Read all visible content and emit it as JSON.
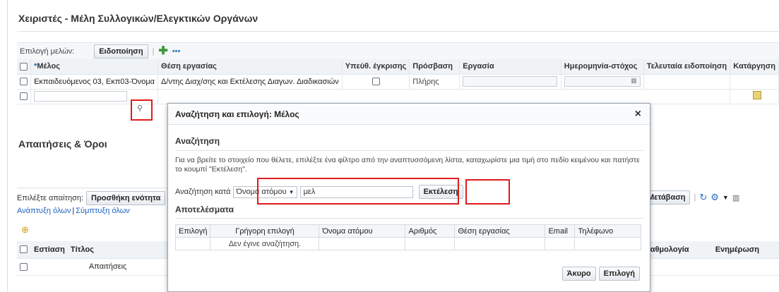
{
  "page": {
    "title": "Χειριστές - Μέλη Συλλογικών/Ελεγκτικών Οργάνων"
  },
  "members": {
    "select_label": "Επιλογή μελών:",
    "notify_button": "Ειδοποίηση",
    "more": "•••",
    "columns": [
      "Μέλος",
      "Θέση εργασίας",
      "Υπεύθ. έγκρισης",
      "Πρόσβαση",
      "Εργασία",
      "Ημερομηνία-στόχος",
      "Τελευταία ειδοποίηση",
      "Κατάργηση"
    ],
    "required_mark": "*",
    "row1": {
      "member": "Εκπαιδευόμενος 03, Εκπ03-Όνομα",
      "position": "Δ/ντης Διαχ/σης και Εκτέλεσης Διαγων. Διαδικασιών",
      "access": "Πλήρης"
    }
  },
  "requirements": {
    "title": "Απαιτήσεις & Όροι",
    "select_label": "Επιλέξτε απαίτηση:",
    "add_button": "Προσθήκη ενότητα",
    "expand_all": "Ανάπτυξη όλων",
    "collapse_all": "Σύμπτυξη όλων",
    "divider": "|",
    "go_button": "Μετάβαση",
    "columns_left": [
      "Εστίαση",
      "Τίτλος"
    ],
    "row_title": "Απαιτήσεις",
    "columns_right": [
      "βαθμολογία",
      "Ενημέρωση"
    ]
  },
  "dialog": {
    "title": "Αναζήτηση και επιλογή: Μέλος",
    "close": "×",
    "search_heading": "Αναζήτηση",
    "hint": "Για να βρείτε το στοιχείο που θέλετε, επιλέξτε ένα φίλτρο από την αναπτυσσόμενη λίστα, καταχωρίστε μια τιμή στο πεδίο κειμένου και πατήστε το κουμπί \"Εκτέλεση\".",
    "search_by_label": "Αναζήτηση κατά",
    "search_by_value": "Όνομα ατόμου",
    "search_value": "μελ",
    "execute_button": "Εκτέλεση",
    "results_heading": "Αποτελέσματα",
    "result_columns": [
      "Επιλογή",
      "Γρήγορη επιλογή",
      "Όνομα ατόμου",
      "Αριθμός",
      "Θέση εργασίας",
      "Email",
      "Τηλέφωνο"
    ],
    "no_search": "Δεν έγινε αναζήτηση.",
    "cancel_button": "Άκυρο",
    "select_button": "Επιλογή"
  }
}
